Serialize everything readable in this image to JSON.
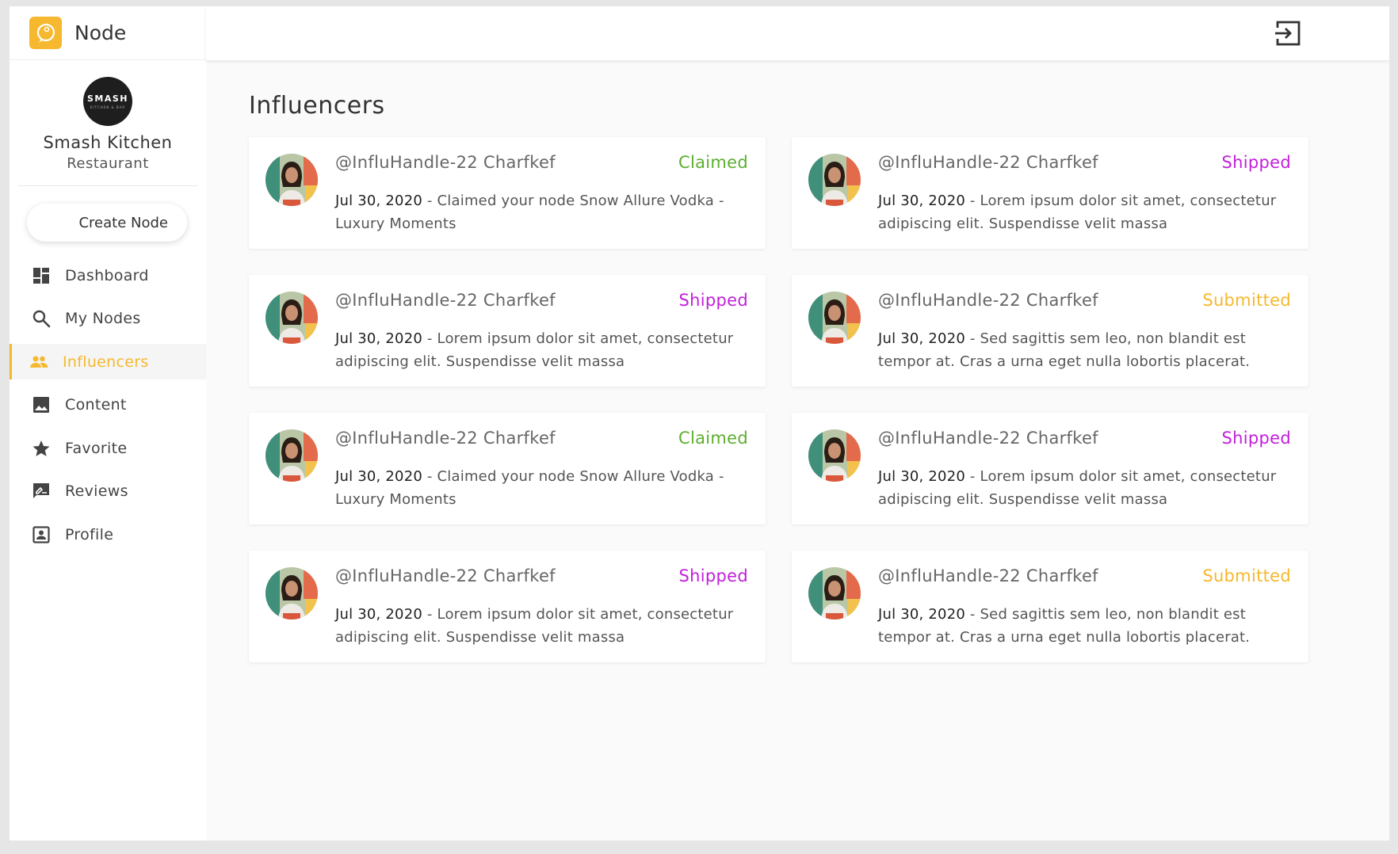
{
  "brand": {
    "name": "Node",
    "logo_icon": "search-bubble-icon",
    "accent": "#f5b82e"
  },
  "account": {
    "logo_text": "SMASH",
    "logo_subtext": "KITCHEN & BAR",
    "name": "Smash Kitchen",
    "type": "Restaurant"
  },
  "sidebar": {
    "create_label": "Create Node",
    "items": [
      {
        "label": "Dashboard",
        "icon": "dashboard-icon"
      },
      {
        "label": "My Nodes",
        "icon": "search-icon"
      },
      {
        "label": "Influencers",
        "icon": "people-icon",
        "active": true
      },
      {
        "label": "Content",
        "icon": "image-icon"
      },
      {
        "label": "Favorite",
        "icon": "star-icon"
      },
      {
        "label": "Reviews",
        "icon": "rate-review-icon"
      },
      {
        "label": "Profile",
        "icon": "profile-icon"
      }
    ]
  },
  "topbar": {
    "logout_icon": "logout-icon"
  },
  "page": {
    "title": "Influencers"
  },
  "status_colors": {
    "Claimed": "#5cae2e",
    "Shipped": "#c21fdb",
    "Submitted": "#f5b82e"
  },
  "cards": [
    {
      "handle": "@InfluHandle-22 Charfkef",
      "status": "Claimed",
      "date": "Jul 30, 2020",
      "text": " - Claimed your node Snow Allure Vodka - Luxury Moments"
    },
    {
      "handle": "@InfluHandle-22 Charfkef",
      "status": "Shipped",
      "date": "Jul 30, 2020",
      "text": " - Lorem ipsum dolor sit amet, consectetur adipiscing elit. Suspendisse velit massa"
    },
    {
      "handle": "@InfluHandle-22 Charfkef",
      "status": "Shipped",
      "date": "Jul 30, 2020",
      "text": " - Lorem ipsum dolor sit amet, consectetur adipiscing elit. Suspendisse velit massa"
    },
    {
      "handle": "@InfluHandle-22 Charfkef",
      "status": "Submitted",
      "date": "Jul 30, 2020",
      "text": " - Sed sagittis sem leo, non blandit est tempor at. Cras a urna eget nulla lobortis placerat."
    },
    {
      "handle": "@InfluHandle-22 Charfkef",
      "status": "Claimed",
      "date": "Jul 30, 2020",
      "text": " - Claimed your node Snow Allure Vodka - Luxury Moments"
    },
    {
      "handle": "@InfluHandle-22 Charfkef",
      "status": "Shipped",
      "date": "Jul 30, 2020",
      "text": " - Lorem ipsum dolor sit amet, consectetur adipiscing elit. Suspendisse velit massa"
    },
    {
      "handle": "@InfluHandle-22 Charfkef",
      "status": "Shipped",
      "date": "Jul 30, 2020",
      "text": " - Lorem ipsum dolor sit amet, consectetur adipiscing elit. Suspendisse velit massa"
    },
    {
      "handle": "@InfluHandle-22 Charfkef",
      "status": "Submitted",
      "date": "Jul 30, 2020",
      "text": " - Sed sagittis sem leo, non blandit est tempor at. Cras a urna eget nulla lobortis placerat."
    }
  ]
}
